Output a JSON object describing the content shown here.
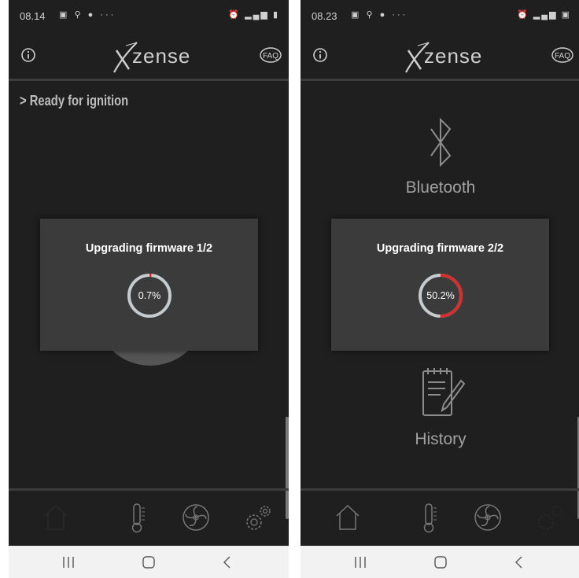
{
  "left": {
    "status_time": "08.14",
    "ready_label": "> Ready for ignition",
    "dialog_title": "Upgrading firmware 1/2",
    "progress_text": "0.7%",
    "progress_fraction": 0.007
  },
  "right": {
    "status_time": "08.23",
    "bluetooth_label": "Bluetooth",
    "history_label": "History",
    "dialog_title": "Upgrading firmware 2/2",
    "progress_text": "50.2%",
    "progress_fraction": 0.502
  },
  "header": {
    "logo_text": "zense",
    "faq_label": "FAQ"
  },
  "colors": {
    "background": "#1f1f1f",
    "dialog": "#3b3b3b",
    "progress_red": "#d32f2f",
    "progress_track": "#c5ccd0"
  },
  "icons": {
    "status": [
      "gallery-icon",
      "usb-icon",
      "facebook-icon",
      "more-icon"
    ],
    "tabs": [
      "home-icon",
      "thermometer-icon",
      "fan-icon",
      "settings-icon"
    ],
    "nav": [
      "recents-icon",
      "home-nav-icon",
      "back-icon"
    ]
  }
}
